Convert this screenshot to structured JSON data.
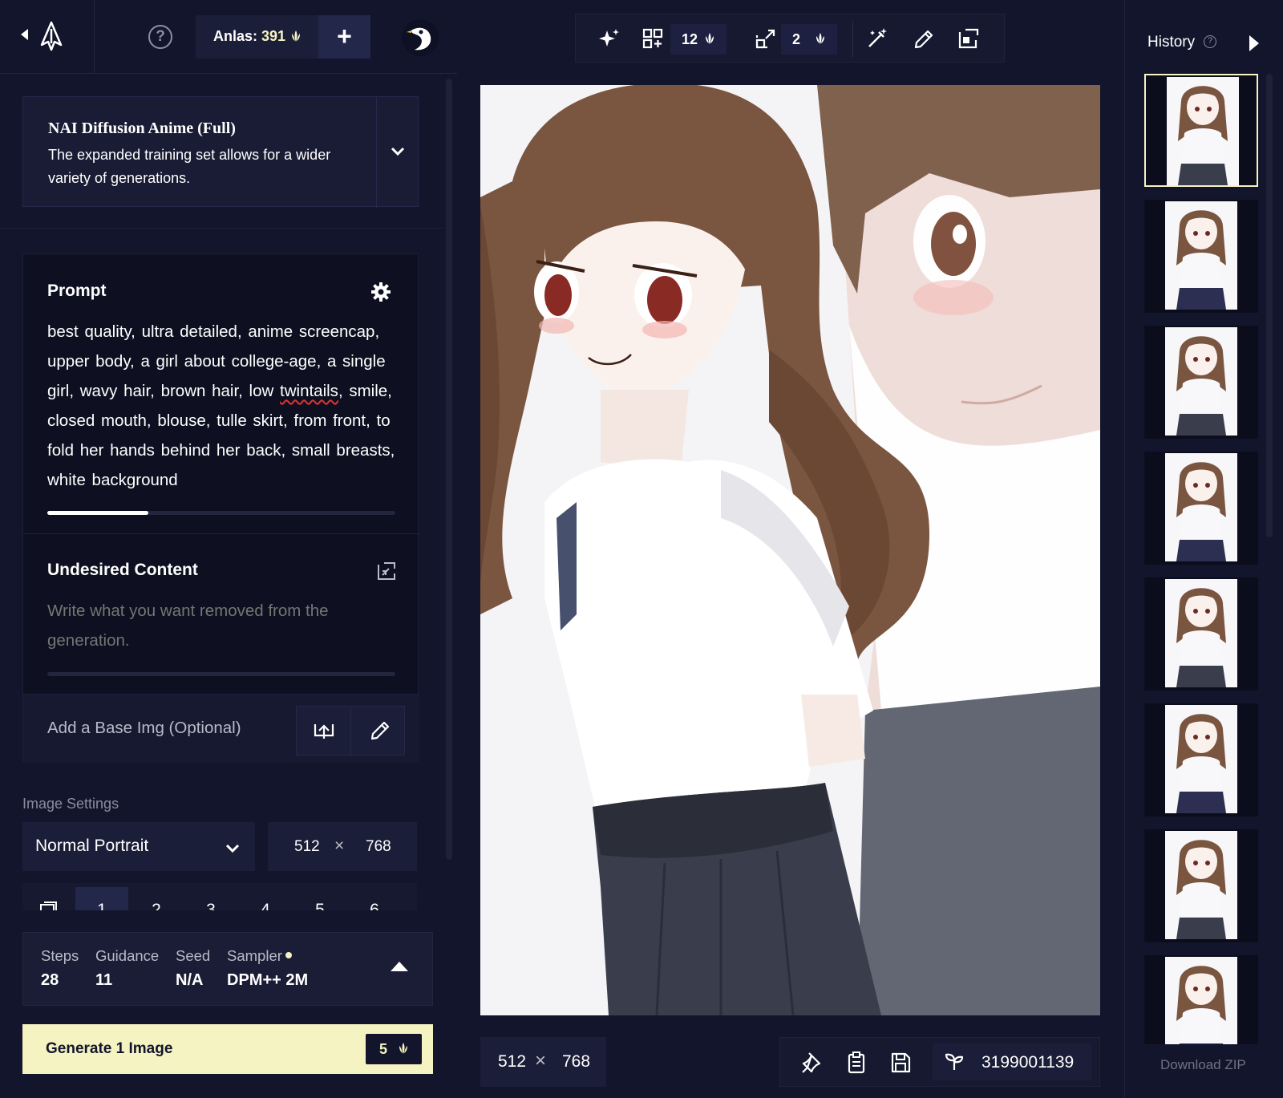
{
  "topbar": {
    "anlas_label": "Anlas:",
    "anlas_value": "391"
  },
  "model": {
    "name": "NAI Diffusion Anime (Full)",
    "description": "The expanded training set allows for a wider variety of generations."
  },
  "prompt": {
    "title": "Prompt",
    "text_before_typo": "best quality, ultra detailed, anime screencap, upper body, a girl about college-age, a single girl, wavy hair, brown hair, low ",
    "typo_word": "twintails",
    "text_after_typo": ", smile, closed mouth, blouse, tulle skirt, from front, to fold her hands behind her back, small breasts, white background",
    "token_usage_fraction": 0.29
  },
  "undesired": {
    "title": "Undesired Content",
    "placeholder": "Write what you want removed from the generation."
  },
  "base_img": {
    "label": "Add a Base Img (Optional)"
  },
  "image_settings": {
    "label": "Image Settings",
    "resolution": "Normal Portrait",
    "width": "512",
    "height": "768",
    "times": "×",
    "counts": [
      "1",
      "2",
      "3",
      "4",
      "5",
      "6"
    ],
    "active_count": "1"
  },
  "params": {
    "steps_label": "Steps",
    "steps_value": "28",
    "guidance_label": "Guidance",
    "guidance_value": "11",
    "seed_label": "Seed",
    "seed_value": "N/A",
    "sampler_label": "Sampler",
    "sampler_value": "DPM++ 2M"
  },
  "generate": {
    "label": "Generate 1 Image",
    "cost": "5"
  },
  "toolbar": {
    "variations_cost": "12",
    "upscale_cost": "2"
  },
  "canvas": {
    "width": "512",
    "height": "768",
    "times": "×",
    "seed": "3199001139"
  },
  "history": {
    "title": "History",
    "help": "?",
    "download_label": "Download ZIP",
    "thumbnail_count": 8
  },
  "colors": {
    "background": "#13152c",
    "panel": "#1b1e38",
    "accent": "#f5f3c2",
    "text": "#ffffff",
    "muted": "#8a8c9e"
  },
  "icons": [
    "back-arrow-icon",
    "novelai-logo-icon",
    "help-icon",
    "anlas-icon",
    "plus-icon",
    "avatar-icon",
    "chevron-down-icon",
    "gear-icon",
    "import-icon",
    "upload-icon",
    "pencil-icon",
    "image-count-icon",
    "chevron-up-icon",
    "sparkle-icon",
    "variations-icon",
    "upscale-icon",
    "enhance-wand-icon",
    "paint-brush-icon",
    "edit-image-icon",
    "pin-icon",
    "clipboard-icon",
    "save-icon",
    "seed-sprout-icon",
    "collapse-arrow-icon"
  ]
}
